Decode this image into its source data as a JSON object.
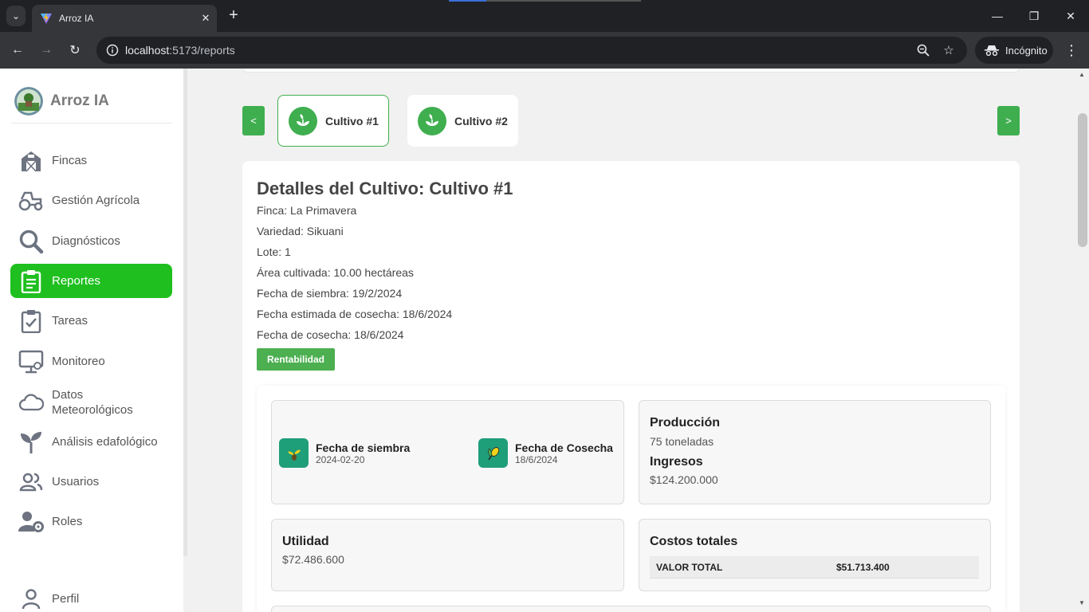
{
  "browser": {
    "tab_title": "Arroz IA",
    "url_host": "localhost",
    "url_path": ":5173/reports",
    "profile_label": "Incógnito"
  },
  "sidebar": {
    "brand": "Arroz IA",
    "items": [
      {
        "label": "Fincas",
        "icon": "barn-icon"
      },
      {
        "label": "Gestión Agrícola",
        "icon": "tractor-icon"
      },
      {
        "label": "Diagnósticos",
        "icon": "search-icon"
      },
      {
        "label": "Reportes",
        "icon": "clipboard-icon",
        "active": true
      },
      {
        "label": "Tareas",
        "icon": "checklist-icon"
      },
      {
        "label": "Monitoreo",
        "icon": "monitor-icon"
      },
      {
        "label": "Datos Meteorológicos",
        "icon": "cloud-icon"
      },
      {
        "label": "Análisis edafológico",
        "icon": "sprout-icon"
      },
      {
        "label": "Usuarios",
        "icon": "users-icon"
      },
      {
        "label": "Roles",
        "icon": "user-gear-icon"
      }
    ],
    "profile": "Perfil"
  },
  "carousel": {
    "prev": "<",
    "next": ">",
    "tabs": [
      {
        "label": "Cultivo #1",
        "selected": true
      },
      {
        "label": "Cultivo #2",
        "selected": false
      }
    ]
  },
  "details": {
    "title": "Detalles del Cultivo: Cultivo #1",
    "finca": "Finca: La Primavera",
    "variedad": "Variedad: Sikuani",
    "lote": "Lote: 1",
    "area": "Área cultivada: 10.00 hectáreas",
    "siembra": "Fecha de siembra: 19/2/2024",
    "estimada": "Fecha estimada de cosecha: 18/6/2024",
    "cosecha": "Fecha de cosecha: 18/6/2024",
    "button": "Rentabilidad"
  },
  "summary": {
    "sowing_title": "Fecha de siembra",
    "sowing_value": "2024-02-20",
    "harvest_title": "Fecha de Cosecha",
    "harvest_value": "18/6/2024",
    "production_title": "Producción",
    "production_value": "75 toneladas",
    "income_title": "Ingresos",
    "income_value": "$124.200.000",
    "profit_title": "Utilidad",
    "profit_value": "$72.486.600",
    "costs_title": "Costos totales",
    "costs_label": "VALOR TOTAL",
    "costs_value": "$51.713.400"
  },
  "colors": {
    "accent": "#1fbf1f",
    "button_green": "#4caf50",
    "icon_teal": "#1f9e7a"
  }
}
